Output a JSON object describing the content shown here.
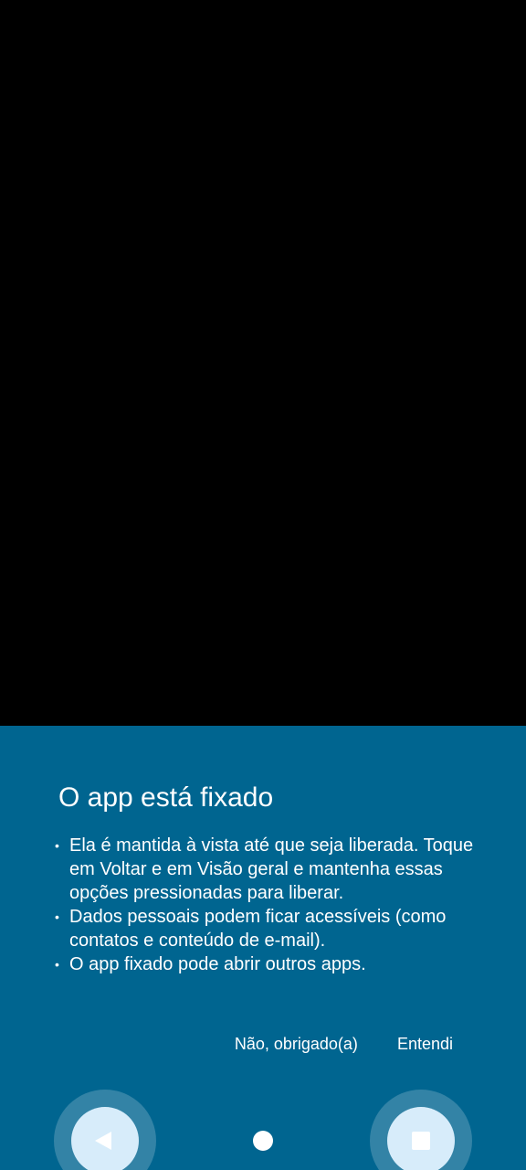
{
  "dialog": {
    "title": "O app está fixado",
    "bullets": [
      "Ela é mantida à vista até que seja liberada. Toque em Voltar e em Visão geral e mantenha essas opções pressionadas para liberar.",
      "Dados pessoais podem ficar acessíveis (como contatos e conteúdo de e-mail).",
      "O app fixado pode abrir outros apps."
    ],
    "bullet_symbol": "•",
    "decline_label": "Não, obrigado(a)",
    "accept_label": "Entendi"
  },
  "colors": {
    "panel_background": "#006590",
    "app_background": "#000000",
    "nav_button_fill": "#d7ecfa"
  },
  "nav": {
    "back_icon": "back-triangle-icon",
    "home_icon": "home-circle-icon",
    "recents_icon": "recents-square-icon"
  }
}
